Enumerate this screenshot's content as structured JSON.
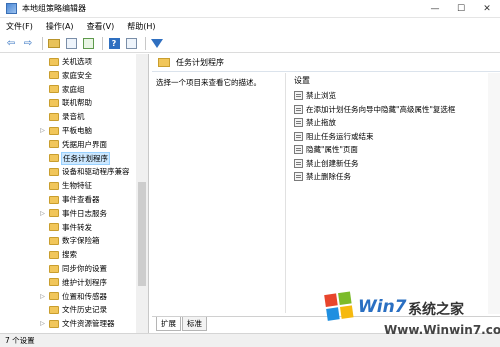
{
  "window": {
    "title": "本地组策略编辑器",
    "minimize": "—",
    "maximize": "☐",
    "close": "✕"
  },
  "menu": [
    "文件(F)",
    "操作(A)",
    "查看(V)",
    "帮助(H)"
  ],
  "toolbar": {
    "back_icon": "arrow-left-icon",
    "forward_icon": "arrow-right-icon",
    "filter_icon": "filter-icon",
    "back_glyph": "⇦",
    "forward_glyph": "⇨",
    "help_glyph": "?"
  },
  "tree": {
    "items": [
      {
        "label": "关机选项",
        "expandable": false,
        "selected": false
      },
      {
        "label": "家庭安全",
        "expandable": false,
        "selected": false
      },
      {
        "label": "家庭组",
        "expandable": false,
        "selected": false
      },
      {
        "label": "联机帮助",
        "expandable": false,
        "selected": false
      },
      {
        "label": "录音机",
        "expandable": false,
        "selected": false
      },
      {
        "label": "平板电脑",
        "expandable": true,
        "selected": false
      },
      {
        "label": "凭据用户界面",
        "expandable": false,
        "selected": false
      },
      {
        "label": "任务计划程序",
        "expandable": false,
        "selected": true
      },
      {
        "label": "设备和驱动程序兼容",
        "expandable": false,
        "selected": false
      },
      {
        "label": "生物特征",
        "expandable": false,
        "selected": false
      },
      {
        "label": "事件查看器",
        "expandable": false,
        "selected": false
      },
      {
        "label": "事件日志服务",
        "expandable": true,
        "selected": false
      },
      {
        "label": "事件转发",
        "expandable": false,
        "selected": false
      },
      {
        "label": "数字保险箱",
        "expandable": false,
        "selected": false
      },
      {
        "label": "搜索",
        "expandable": false,
        "selected": false
      },
      {
        "label": "同步你的设置",
        "expandable": false,
        "selected": false
      },
      {
        "label": "维护计划程序",
        "expandable": false,
        "selected": false
      },
      {
        "label": "位置和传感器",
        "expandable": true,
        "selected": false
      },
      {
        "label": "文件历史记录",
        "expandable": false,
        "selected": false
      },
      {
        "label": "文件资源管理器",
        "expandable": true,
        "selected": false
      }
    ]
  },
  "main": {
    "header_title": "任务计划程序",
    "description": "选择一个项目来查看它的描述。",
    "column_header": "设置",
    "settings": [
      "禁止浏览",
      "在添加计划任务向导中隐藏\"高级属性\"复选框",
      "禁止拖放",
      "阻止任务运行或结束",
      "隐藏\"属性\"页面",
      "禁止创建新任务",
      "禁止删除任务"
    ],
    "tabs": [
      "扩展",
      "标准"
    ]
  },
  "status": {
    "text": "7 个设置"
  },
  "watermark": {
    "brand": "Win7",
    "sub": "系统之家",
    "url": "Www.Winwin7.com"
  }
}
